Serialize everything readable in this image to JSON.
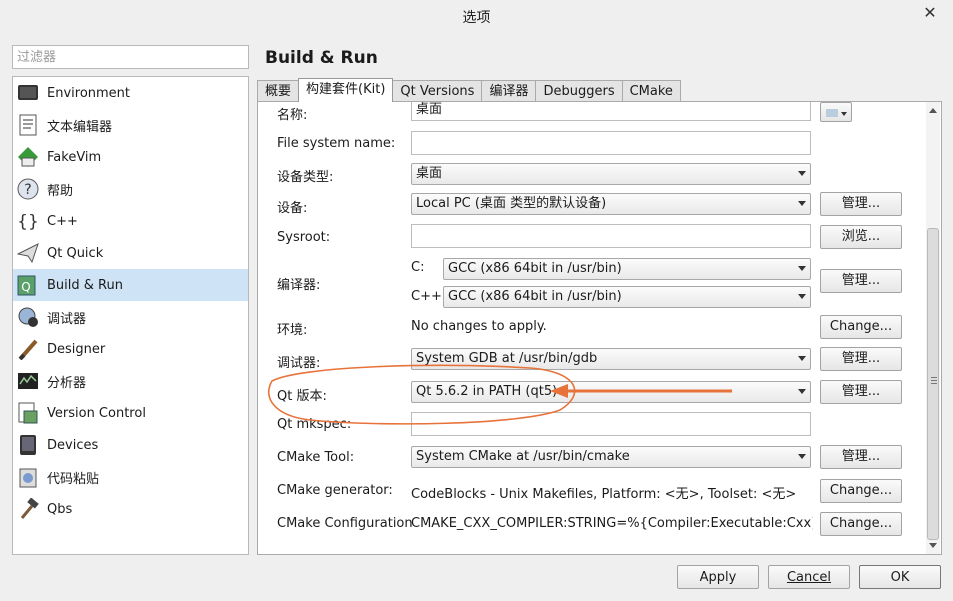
{
  "window": {
    "title": "选项"
  },
  "filter": {
    "placeholder": "过滤器"
  },
  "sidebar": {
    "items": [
      {
        "label": "Environment"
      },
      {
        "label": "文本编辑器"
      },
      {
        "label": "FakeVim"
      },
      {
        "label": "帮助"
      },
      {
        "label": "C++"
      },
      {
        "label": "Qt Quick"
      },
      {
        "label": "Build & Run"
      },
      {
        "label": "调试器"
      },
      {
        "label": "Designer"
      },
      {
        "label": "分析器"
      },
      {
        "label": "Version Control"
      },
      {
        "label": "Devices"
      },
      {
        "label": "代码粘贴"
      },
      {
        "label": "Qbs"
      }
    ],
    "selected": "Build & Run"
  },
  "page": {
    "title": "Build & Run"
  },
  "tabs": [
    {
      "label": "概要"
    },
    {
      "label": "构建套件(Kit)"
    },
    {
      "label": "Qt Versions"
    },
    {
      "label": "编译器"
    },
    {
      "label": "Debuggers"
    },
    {
      "label": "CMake"
    }
  ],
  "form": {
    "name_label": "名称:",
    "name_value": "桌面",
    "fs_label": "File system name:",
    "fs_value": "",
    "device_type_label": "设备类型:",
    "device_type_value": "桌面",
    "device_label": "设备:",
    "device_value": "Local PC (桌面 类型的默认设备)",
    "sysroot_label": "Sysroot:",
    "sysroot_value": "",
    "compiler_label": "编译器:",
    "compiler_c_label": "C:",
    "compiler_c_value": "GCC (x86 64bit in /usr/bin)",
    "compiler_cpp_label": "C++:",
    "compiler_cpp_value": "GCC (x86 64bit in /usr/bin)",
    "env_label": "环境:",
    "env_value": "No changes to apply.",
    "debugger_label": "调试器:",
    "debugger_value": "System GDB at /usr/bin/gdb",
    "qtversion_label": "Qt 版本:",
    "qtversion_value": "Qt 5.6.2 in PATH (qt5)",
    "mkspec_label": "Qt mkspec:",
    "mkspec_value": "",
    "cmaketool_label": "CMake Tool:",
    "cmaketool_value": "System CMake at /usr/bin/cmake",
    "cmakegen_label": "CMake generator:",
    "cmakegen_value": "CodeBlocks - Unix Makefiles, Platform: <无>, Toolset: <无>",
    "cmakeconf_label": "CMake Configuration",
    "cmakeconf_value": "CMAKE_CXX_COMPILER:STRING=%{Compiler:Executable:Cxx}; C···",
    "manage_label": "管理...",
    "browse_label": "浏览...",
    "change_label": "Change..."
  },
  "buttons": {
    "apply": "Apply",
    "cancel": "Cancel",
    "ok": "OK"
  },
  "annotation": {
    "color": "#e8733a"
  }
}
